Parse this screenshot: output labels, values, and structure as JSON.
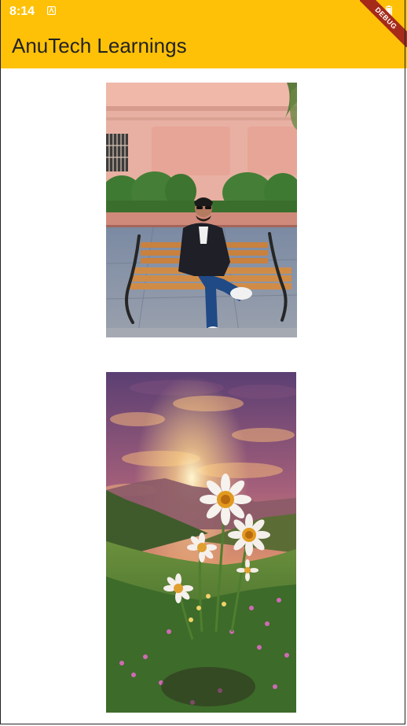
{
  "status_bar": {
    "time": "8:14",
    "notification_icon": "android-icon",
    "battery_icon": "battery-icon"
  },
  "app_bar": {
    "title": "AnuTech Learnings",
    "background": "#FFC107"
  },
  "debug_banner": {
    "label": "DEBUG"
  },
  "images": [
    {
      "description": "photo-man-on-bench",
      "kind": "photo"
    },
    {
      "description": "photo-sunset-daisies",
      "kind": "photo"
    }
  ]
}
